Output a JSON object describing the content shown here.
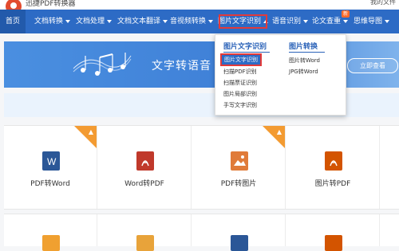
{
  "header": {
    "app_title": "迅捷PDF转换器",
    "my_files": "我的文件"
  },
  "nav": {
    "items": [
      {
        "label": "首页"
      },
      {
        "label": "文档转换"
      },
      {
        "label": "文档处理"
      },
      {
        "label": "文档文本翻译"
      },
      {
        "label": "音视频转换"
      },
      {
        "label": "图片文字识别"
      },
      {
        "label": "语音识别"
      },
      {
        "label": "论文查重"
      },
      {
        "label": "思维导图"
      }
    ],
    "new_badge": "新"
  },
  "banner": {
    "text": "文字转语音",
    "button": "立即查看"
  },
  "dropdown": {
    "col1_title": "图片文字识别",
    "col1_items": [
      "图片文字识别",
      "扫描PDF识别",
      "扫描票证识别",
      "图片局部识别",
      "手写文字识别"
    ],
    "col2_title": "图片转换",
    "col2_items": [
      "图片转Word",
      "JPG转Word"
    ]
  },
  "cards": [
    {
      "label": "PDF转Word",
      "icon": "word-icon",
      "color": "#2b5797",
      "hot": true
    },
    {
      "label": "Word转PDF",
      "icon": "pdf-icon",
      "color": "#c0392b",
      "hot": false
    },
    {
      "label": "PDF转图片",
      "icon": "image-icon",
      "color": "#e07b39",
      "hot": true
    },
    {
      "label": "图片转PDF",
      "icon": "pdf-image-icon",
      "color": "#d35400",
      "hot": false
    }
  ],
  "colors": {
    "nav_bg": "#2d6bc5",
    "accent": "#2a62b8",
    "highlight": "#e23a3a"
  }
}
